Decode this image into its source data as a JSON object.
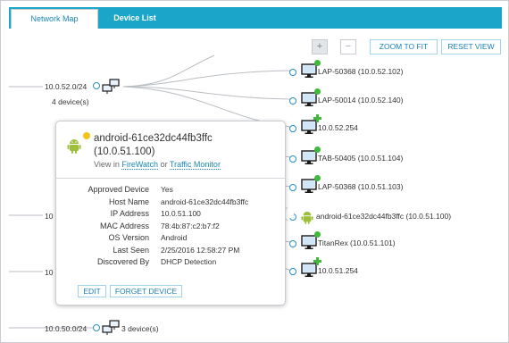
{
  "tabs": [
    {
      "label": "Network Map",
      "active": true
    },
    {
      "label": "Device List",
      "active": false
    }
  ],
  "toolbar": {
    "zoom_in": "+",
    "zoom_out": "−",
    "zoom_fit": "ZOOM TO FIT",
    "reset_view": "RESET VIEW"
  },
  "networks": [
    {
      "subnet": "10.0.52.0/24",
      "count": "4 device(s)"
    },
    {
      "subnet_partial": "10"
    },
    {
      "subnet_partial": "10"
    },
    {
      "subnet": "10.0.50.0/24",
      "count": "3 device(s)"
    }
  ],
  "devices": [
    {
      "label": "LAP-50368 (10.0.52.102)",
      "type": "monitor",
      "status": "green"
    },
    {
      "label": "LAP-50014 (10.0.52.140)",
      "type": "monitor",
      "status": "green"
    },
    {
      "label": "10.0.52.254",
      "type": "monitor",
      "status": "plus"
    },
    {
      "label": "TAB-50405 (10.0.51.104)",
      "type": "monitor",
      "status": "green"
    },
    {
      "label": "LAP-50368 (10.0.51.103)",
      "type": "monitor",
      "status": "green"
    },
    {
      "label": "android-61ce32dc44fb3ffc (10.0.51.100)",
      "type": "android",
      "status": "yellow"
    },
    {
      "label": "TitanRex (10.0.51.101)",
      "type": "monitor",
      "status": "green"
    },
    {
      "label": "10.0.51.254",
      "type": "monitor",
      "status": "plus"
    }
  ],
  "popup": {
    "title": "android-61ce32dc44fb3ffc (10.0.51.100)",
    "status": "yellow",
    "view_prefix": "View in",
    "link_firewatch": "FireWatch",
    "view_or": "or",
    "link_traffic": "Traffic Monitor",
    "fields": [
      {
        "key": "Approved Device",
        "value": "Yes"
      },
      {
        "key": "Host Name",
        "value": "android-61ce32dc44fb3ffc"
      },
      {
        "key": "IP Address",
        "value": "10.0.51.100"
      },
      {
        "key": "MAC Address",
        "value": "78:4b:87:c2:b7:f2"
      },
      {
        "key": "OS Version",
        "value": "Android"
      },
      {
        "key": "Last Seen",
        "value": "2/25/2016 12:58:27 PM"
      },
      {
        "key": "Discovered By",
        "value": "DHCP Detection"
      }
    ],
    "edit": "EDIT",
    "forget": "FORGET DEVICE"
  },
  "colors": {
    "tab_bar": "#1ba6c9",
    "link": "#1b87b3",
    "status_green": "#3fb83b",
    "status_yellow": "#f0c419",
    "port_blue": "#2a8fc4"
  }
}
